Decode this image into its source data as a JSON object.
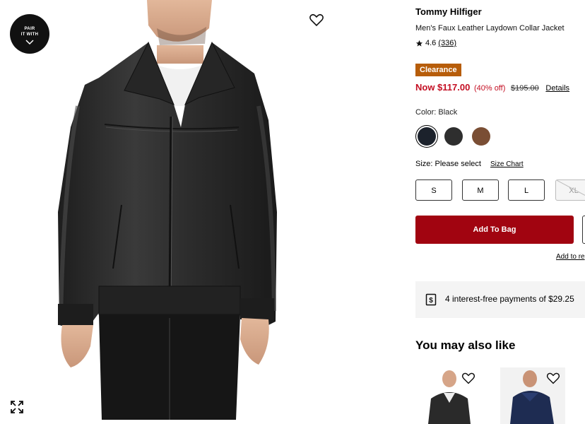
{
  "gallery": {
    "pair_badge_line1": "PAIR",
    "pair_badge_line2": "IT WITH"
  },
  "product": {
    "brand": "Tommy Hilfiger",
    "name": "Men's Faux Leather Laydown Collar Jacket",
    "rating": "4.6",
    "review_count": "(336)",
    "badge": "Clearance",
    "price_now": "Now $117.00",
    "discount": "(40% off)",
    "price_original": "$195.00",
    "details_link": "Details",
    "color_label": "Color: Black",
    "swatches": [
      {
        "name": "Black",
        "color": "#1c222c",
        "selected": true
      },
      {
        "name": "Charcoal",
        "color": "#2e2e2e",
        "selected": false
      },
      {
        "name": "Brown",
        "color": "#7a4e34",
        "selected": false
      }
    ],
    "size_label": "Size: Please select",
    "size_chart_link": "Size Chart",
    "sizes": [
      {
        "label": "S",
        "available": true
      },
      {
        "label": "M",
        "available": true
      },
      {
        "label": "L",
        "available": true
      },
      {
        "label": "XL",
        "available": false
      }
    ],
    "add_to_bag": "Add To Bag",
    "add_to_registry": "Add to re",
    "installments": "4 interest-free payments of $29.25"
  },
  "recommendations": {
    "heading": "You may also like"
  },
  "colors": {
    "sale_red": "#c40f23",
    "cta_red": "#a10410",
    "clearance_orange": "#b75d0a"
  }
}
